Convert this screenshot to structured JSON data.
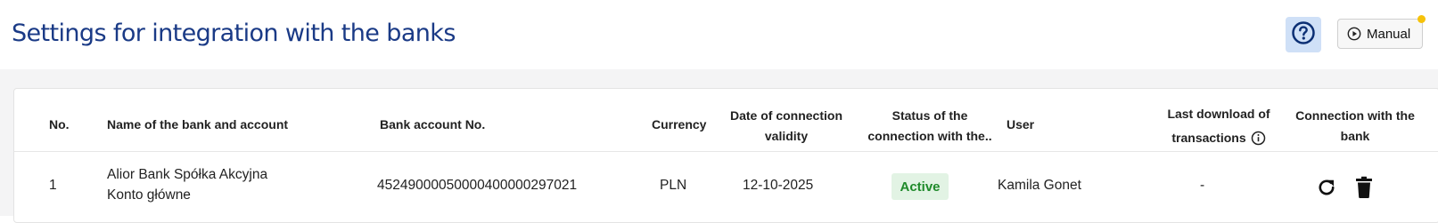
{
  "page": {
    "title": "Settings for integration with the banks"
  },
  "header": {
    "help_icon": "question-circle-icon",
    "manual_label": "Manual",
    "manual_icon": "play-circle-icon"
  },
  "table": {
    "columns": {
      "no": "No.",
      "bank": "Name of the bank and account",
      "account_no": "Bank account No.",
      "currency": "Currency",
      "date_line1": "Date of connection",
      "date_line2": "validity",
      "status_line1": "Status of the",
      "status_line2": "connection with the..",
      "user": "User",
      "last_line1": "Last download of",
      "last_line2": "transactions",
      "conn_line1": "Connection with the",
      "conn_line2": "bank"
    },
    "rows": [
      {
        "no": "1",
        "bank_line1": "Alior Bank Spółka Akcyjna",
        "bank_line2": "Konto główne",
        "account_no": "45249000050000400000297021",
        "currency": "PLN",
        "date": "12-10-2025",
        "status": "Active",
        "user": "Kamila Gonet",
        "last_download": "-"
      }
    ]
  }
}
